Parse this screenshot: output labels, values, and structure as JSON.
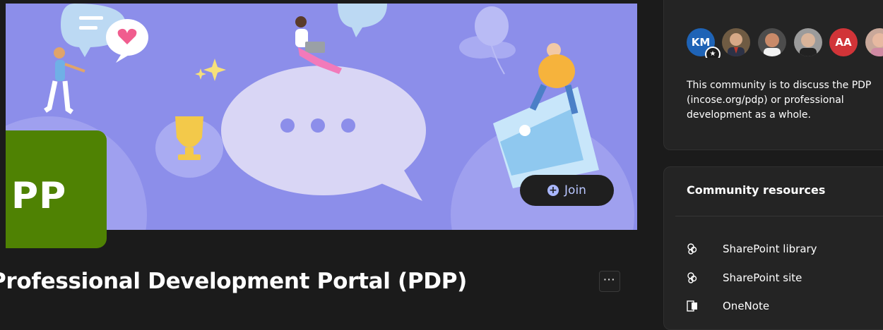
{
  "community": {
    "logo_initials": "PP",
    "join_label": "Join",
    "title": "Professional Development Portal (PDP)",
    "more_label": "···"
  },
  "members": {
    "avatars": [
      {
        "initials": "KM",
        "color": "#1e63b6",
        "badge": "star-icon"
      },
      {
        "initials": "",
        "kind": "photo"
      },
      {
        "initials": "",
        "kind": "photo"
      },
      {
        "initials": "",
        "kind": "photo"
      },
      {
        "initials": "AA",
        "color": "#d13438"
      },
      {
        "initials": "",
        "kind": "photo"
      }
    ]
  },
  "about": {
    "description": "This community is to discuss the PDP (incose.org/pdp) or professional development as a whole."
  },
  "resources": {
    "title": "Community resources",
    "items": [
      {
        "label": "SharePoint library",
        "icon": "sharepoint-icon"
      },
      {
        "label": "SharePoint site",
        "icon": "sharepoint-icon"
      },
      {
        "label": "OneNote",
        "icon": "onenote-icon"
      }
    ]
  },
  "colors": {
    "page_bg": "#1b1b1b",
    "cover_bg": "#8c8eea",
    "logo_tile": "#4f8203",
    "join_text": "#b9c6ff",
    "avatar_km": "#1e63b6",
    "avatar_aa": "#d13438"
  }
}
